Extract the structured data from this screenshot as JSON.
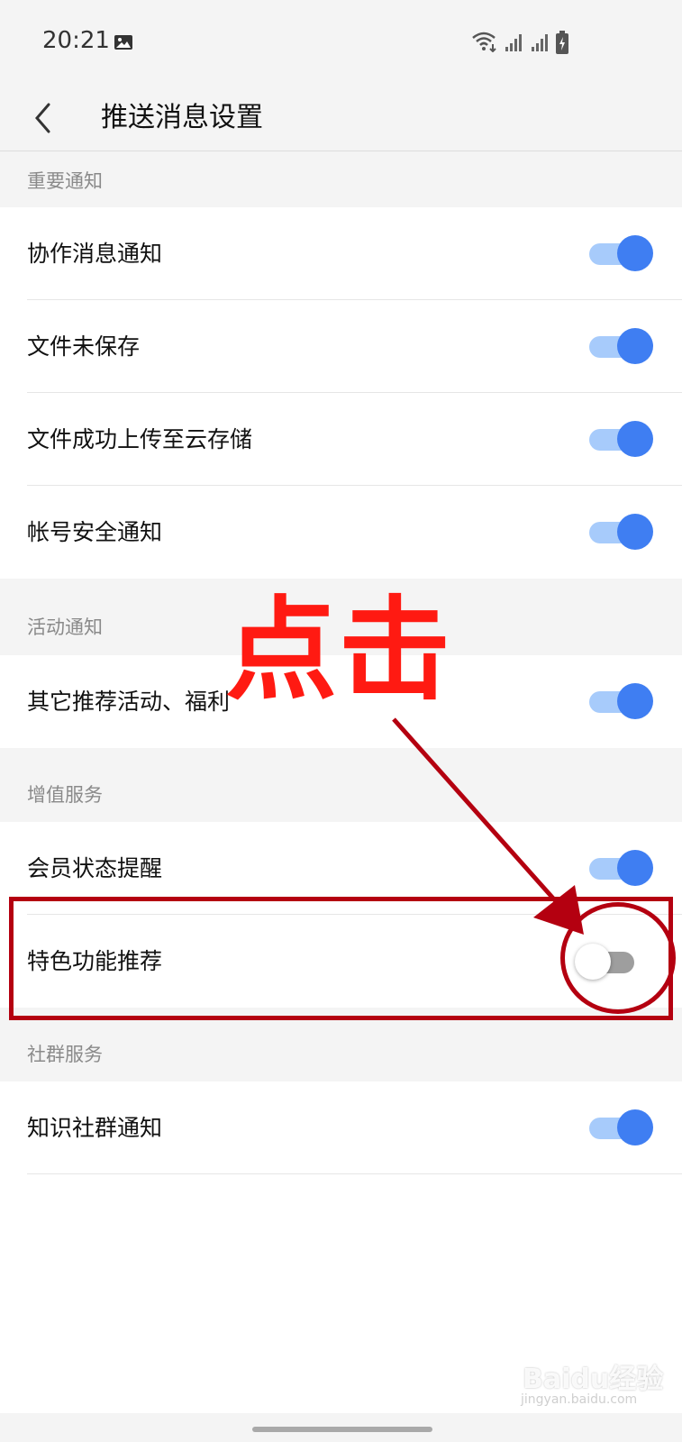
{
  "status_bar": {
    "time": "20:21"
  },
  "header": {
    "title": "推送消息设置"
  },
  "sections": [
    {
      "label": "重要通知",
      "items": [
        {
          "label": "协作消息通知",
          "on": true
        },
        {
          "label": "文件未保存",
          "on": true
        },
        {
          "label": "文件成功上传至云存储",
          "on": true
        },
        {
          "label": "帐号安全通知",
          "on": true
        }
      ]
    },
    {
      "label": "活动通知",
      "items": [
        {
          "label": "其它推荐活动、福利",
          "on": true
        }
      ]
    },
    {
      "label": "增值服务",
      "items": [
        {
          "label": "会员状态提醒",
          "on": true
        },
        {
          "label": "特色功能推荐",
          "on": false
        }
      ]
    },
    {
      "label": "社群服务",
      "items": [
        {
          "label": "知识社群通知",
          "on": true
        }
      ]
    }
  ],
  "annotation": {
    "text": "点击",
    "color": "#ff1a12",
    "frame_color": "#b40010"
  },
  "watermark": {
    "text": "Baidu经验",
    "sub": "jingyan.baidu.com"
  },
  "colors": {
    "toggle_on_knob": "#3f7ef2",
    "toggle_on_track": "#a7cbfb",
    "toggle_off_track": "#9e9e9e"
  }
}
